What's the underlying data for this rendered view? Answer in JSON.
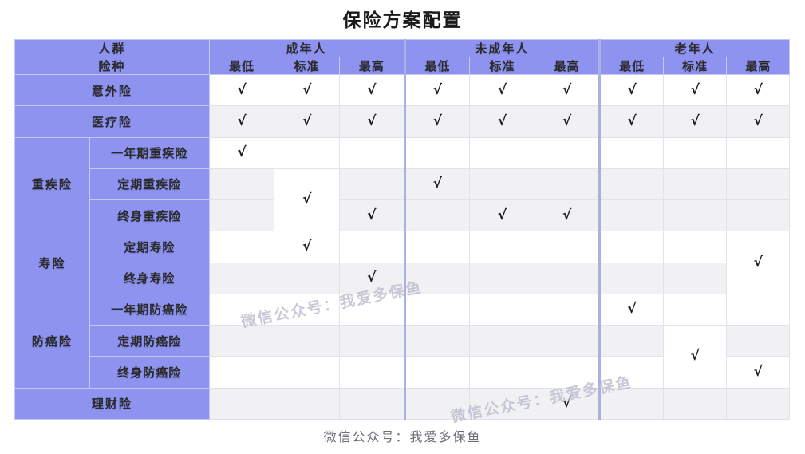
{
  "title": "保险方案配置",
  "footer": "微信公众号：我爱多保鱼",
  "watermarks": [
    "微信公众号：我爱多保鱼",
    "微信公众号：我爱多保鱼"
  ],
  "colors": {
    "header_bg": "#8d93ef",
    "header_text": "#ffffff",
    "row_white": "#ffffff",
    "row_gray": "#f1f1f3",
    "grid_line": "#e2e2ea",
    "group_divider": "#a9b0e4",
    "check_mark": "#1f1f1f",
    "watermark": "#b9bccd",
    "title_text": "#1b1b1b",
    "footer_text": "#6d6d74"
  },
  "table": {
    "corner_label_top": "人群",
    "corner_label_bottom": "险种",
    "check_symbol": "√",
    "groups": [
      {
        "label": "成年人",
        "levels": [
          "最低",
          "标准",
          "最高"
        ]
      },
      {
        "label": "未成年人",
        "levels": [
          "最低",
          "标准",
          "最高"
        ]
      },
      {
        "label": "老年人",
        "levels": [
          "最低",
          "标准",
          "最高"
        ]
      }
    ],
    "columns": [
      "成年人-最低",
      "成年人-标准",
      "成年人-最高",
      "未成年人-最低",
      "未成年人-标准",
      "未成年人-最高",
      "老年人-最低",
      "老年人-标准",
      "老年人-最高"
    ],
    "rows": [
      {
        "group": null,
        "name": "意外险",
        "full_width_label": true,
        "stripe": "white",
        "marks": [
          true,
          true,
          true,
          true,
          true,
          true,
          true,
          true,
          true
        ]
      },
      {
        "group": null,
        "name": "医疗险",
        "full_width_label": true,
        "stripe": "gray",
        "marks": [
          true,
          true,
          true,
          true,
          true,
          true,
          true,
          true,
          true
        ]
      },
      {
        "group": "重疾险",
        "group_rowspan": 3,
        "name": "一年期重疾险",
        "full_width_label": false,
        "stripe": "white",
        "marks": [
          true,
          false,
          false,
          false,
          false,
          false,
          false,
          false,
          false
        ]
      },
      {
        "group": null,
        "name": "定期重疾险",
        "full_width_label": false,
        "stripe": "gray",
        "marks": [
          false,
          "merged-start",
          false,
          true,
          false,
          false,
          false,
          false,
          false
        ]
      },
      {
        "group": null,
        "name": "终身重疾险",
        "full_width_label": false,
        "stripe": "gray",
        "marks": [
          false,
          "merged-cont",
          true,
          false,
          true,
          true,
          false,
          false,
          false
        ]
      },
      {
        "group": "寿险",
        "group_rowspan": 2,
        "name": "定期寿险",
        "full_width_label": false,
        "stripe": "white",
        "marks": [
          false,
          true,
          false,
          false,
          false,
          false,
          false,
          false,
          "merged-start"
        ]
      },
      {
        "group": null,
        "name": "终身寿险",
        "full_width_label": false,
        "stripe": "gray",
        "marks": [
          false,
          false,
          true,
          false,
          false,
          false,
          false,
          false,
          "merged-cont"
        ]
      },
      {
        "group": "防癌险",
        "group_rowspan": 3,
        "name": "一年期防癌险",
        "full_width_label": false,
        "stripe": "white",
        "marks": [
          false,
          false,
          false,
          false,
          false,
          false,
          true,
          false,
          false
        ]
      },
      {
        "group": null,
        "name": "定期防癌险",
        "full_width_label": false,
        "stripe": "gray",
        "marks": [
          false,
          false,
          false,
          false,
          false,
          false,
          false,
          "merged-start",
          false
        ]
      },
      {
        "group": null,
        "name": "终身防癌险",
        "full_width_label": false,
        "stripe": "white",
        "marks": [
          false,
          false,
          false,
          false,
          false,
          false,
          false,
          "merged-cont",
          true
        ]
      },
      {
        "group": null,
        "name": "理财险",
        "full_width_label": true,
        "stripe": "gray",
        "marks": [
          false,
          false,
          false,
          false,
          false,
          true,
          false,
          false,
          false
        ]
      }
    ]
  }
}
